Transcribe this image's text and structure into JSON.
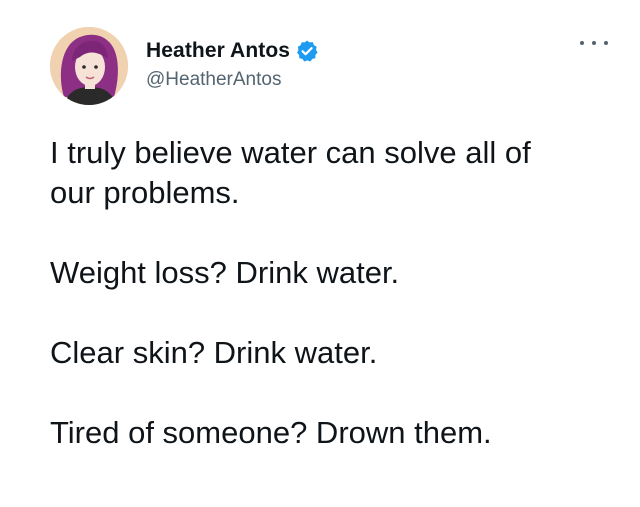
{
  "author": {
    "display_name": "Heather Antos",
    "handle": "@HeatherAntos",
    "verified": true,
    "avatar_icon": "avatar-illustration",
    "verified_icon": "verified-badge-icon",
    "verified_color": "#1d9bf0"
  },
  "menu": {
    "icon": "more-options-icon"
  },
  "tweet": {
    "lines": [
      "I truly believe water can solve all of",
      "our problems.",
      "Weight loss? Drink water.",
      "Clear skin? Drink water.",
      "Tired of someone? Drown them."
    ]
  },
  "colors": {
    "text": "#0f1419",
    "secondary": "#536471",
    "background": "#ffffff"
  }
}
